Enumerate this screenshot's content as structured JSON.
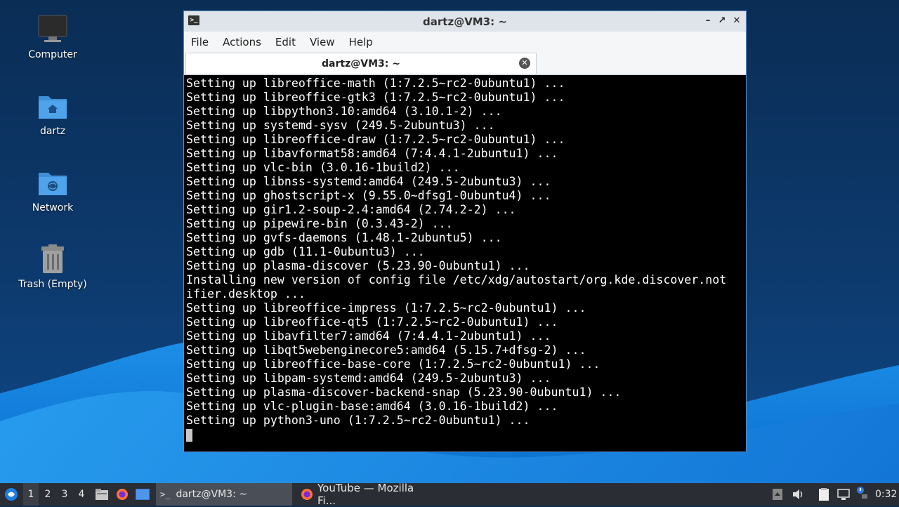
{
  "desktop": {
    "icons": [
      {
        "label": "Computer",
        "icon": "monitor-icon"
      },
      {
        "label": "dartz",
        "icon": "home-folder-icon"
      },
      {
        "label": "Network",
        "icon": "network-folder-icon"
      },
      {
        "label": "Trash (Empty)",
        "icon": "trash-icon"
      }
    ]
  },
  "window": {
    "title": "dartz@VM3: ~",
    "menu": [
      "File",
      "Actions",
      "Edit",
      "View",
      "Help"
    ],
    "tab_label": "dartz@VM3: ~",
    "terminal_lines": [
      "Setting up libreoffice-math (1:7.2.5~rc2-0ubuntu1) ...",
      "Setting up libreoffice-gtk3 (1:7.2.5~rc2-0ubuntu1) ...",
      "Setting up libpython3.10:amd64 (3.10.1-2) ...",
      "Setting up systemd-sysv (249.5-2ubuntu3) ...",
      "Setting up libreoffice-draw (1:7.2.5~rc2-0ubuntu1) ...",
      "Setting up libavformat58:amd64 (7:4.4.1-2ubuntu1) ...",
      "Setting up vlc-bin (3.0.16-1build2) ...",
      "Setting up libnss-systemd:amd64 (249.5-2ubuntu3) ...",
      "Setting up ghostscript-x (9.55.0~dfsg1-0ubuntu4) ...",
      "Setting up gir1.2-soup-2.4:amd64 (2.74.2-2) ...",
      "Setting up pipewire-bin (0.3.43-2) ...",
      "Setting up gvfs-daemons (1.48.1-2ubuntu5) ...",
      "Setting up gdb (11.1-0ubuntu3) ...",
      "Setting up plasma-discover (5.23.90-0ubuntu1) ...",
      "Installing new version of config file /etc/xdg/autostart/org.kde.discover.not",
      "ifier.desktop ...",
      "Setting up libreoffice-impress (1:7.2.5~rc2-0ubuntu1) ...",
      "Setting up libreoffice-qt5 (1:7.2.5~rc2-0ubuntu1) ...",
      "Setting up libavfilter7:amd64 (7:4.4.1-2ubuntu1) ...",
      "Setting up libqt5webenginecore5:amd64 (5.15.7+dfsg-2) ...",
      "Setting up libreoffice-base-core (1:7.2.5~rc2-0ubuntu1) ...",
      "Setting up libpam-systemd:amd64 (249.5-2ubuntu3) ...",
      "Setting up plasma-discover-backend-snap (5.23.90-0ubuntu1) ...",
      "Setting up vlc-plugin-base:amd64 (3.0.16-1build2) ...",
      "Setting up python3-uno (1:7.2.5~rc2-0ubuntu1) ..."
    ]
  },
  "taskbar": {
    "workspaces": [
      "1",
      "2",
      "3",
      "4"
    ],
    "active_workspace": "1",
    "tasks": [
      {
        "label": "dartz@VM3: ~",
        "icon": "terminal-icon",
        "active": true
      },
      {
        "label": "YouTube — Mozilla Fi...",
        "icon": "firefox-icon",
        "active": false
      }
    ],
    "clock": "0:32"
  },
  "colors": {
    "accent": "#5b8ac4",
    "terminal_bg": "#000000",
    "terminal_fg": "#ffffff",
    "taskbar_bg": "#2a2d33"
  }
}
